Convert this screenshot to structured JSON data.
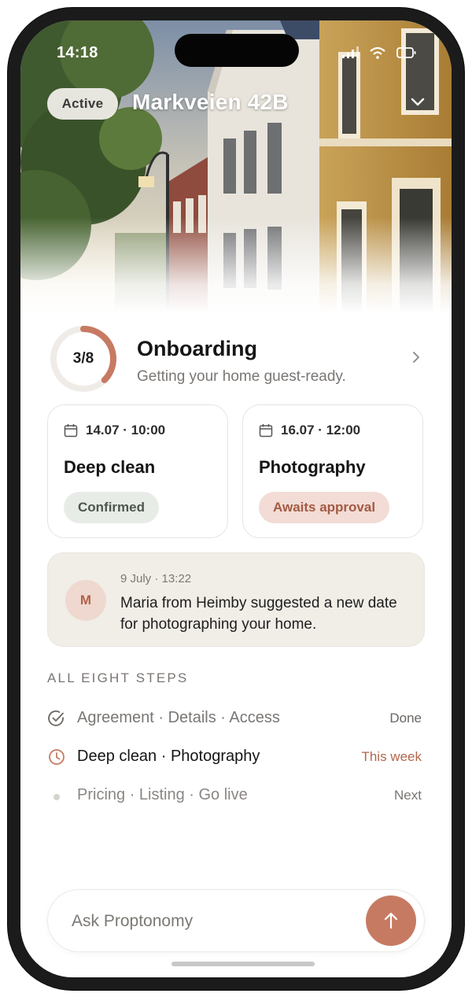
{
  "status_bar": {
    "time": "14:18"
  },
  "header": {
    "status_pill": "Active",
    "address": "Markveien 42B"
  },
  "onboarding": {
    "progress_label": "3/8",
    "progress_fraction": 0.375,
    "title": "Onboarding",
    "subtitle": "Getting your home guest-ready."
  },
  "appointments": [
    {
      "date": "14.07 · 10:00",
      "title": "Deep clean",
      "status": "Confirmed"
    },
    {
      "date": "16.07 · 12:00",
      "title": "Photography",
      "status": "Awaits approval"
    }
  ],
  "message": {
    "avatar_initial": "M",
    "timestamp": "9 July · 13:22",
    "text": "Maria from Heimby suggested a new date for photographing your home."
  },
  "steps": {
    "heading": "ALL EIGHT STEPS",
    "items": [
      {
        "label": "Agreement · Details · Access",
        "status": "Done",
        "icon": "check-circle-icon"
      },
      {
        "label": "Deep clean · Photography",
        "status": "This week",
        "icon": "clock-icon"
      },
      {
        "label": "Pricing · Listing · Go live",
        "status": "Next",
        "icon": "dot-icon"
      }
    ]
  },
  "ask_bar": {
    "placeholder": "Ask Proptonomy"
  },
  "colors": {
    "accent": "#C77A62",
    "confirmed_bg": "#E8ECE7",
    "awaiting_bg": "#F2DCD5",
    "message_bg": "#F1EDE7"
  }
}
